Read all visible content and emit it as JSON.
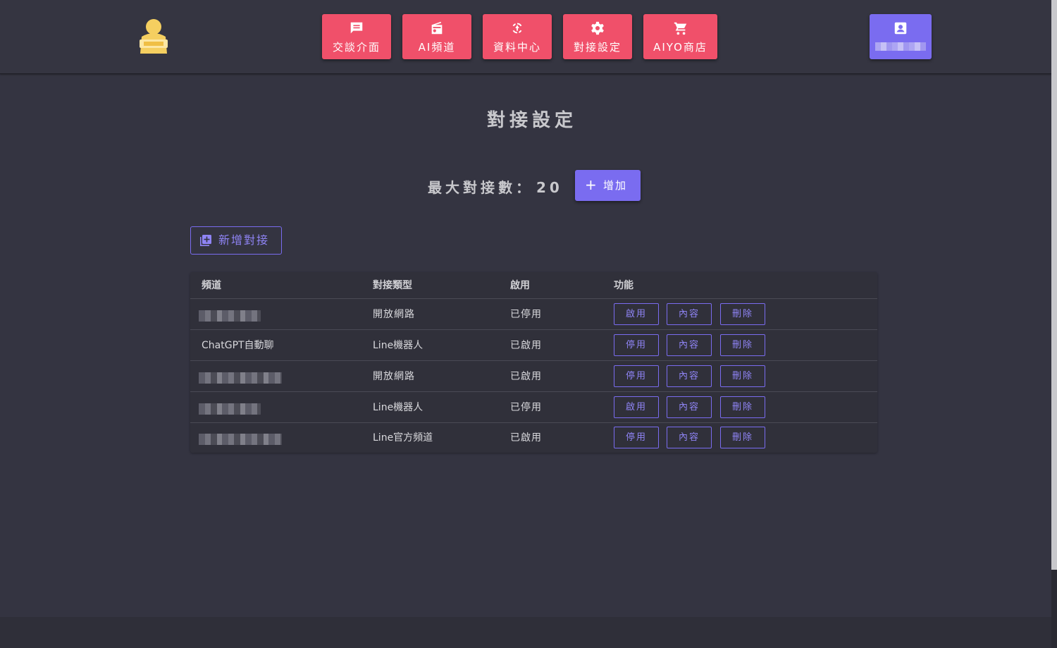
{
  "nav": {
    "items": [
      {
        "label": "交談介面",
        "icon": "chat-icon"
      },
      {
        "label": "AI頻道",
        "icon": "radio-icon"
      },
      {
        "label": "資料中心",
        "icon": "sync-icon"
      },
      {
        "label": "對接設定",
        "icon": "gear-icon"
      },
      {
        "label": "AIYO商店",
        "icon": "cart-icon"
      }
    ],
    "user_icon": "account-box-icon"
  },
  "page": {
    "title": "對接設定",
    "max_label": "最大對接數：",
    "max_value": "20",
    "add_label": "增加",
    "new_connection_label": "新增對接"
  },
  "table": {
    "headers": [
      "頻道",
      "對接類型",
      "啟用",
      "功能"
    ],
    "rows": [
      {
        "channel": "",
        "type": "開放網路",
        "status": "已停用",
        "toggle": "啟用",
        "detail": "內容",
        "delete": "刪除"
      },
      {
        "channel": "ChatGPT自動聊",
        "type": "Line機器人",
        "status": "已啟用",
        "toggle": "停用",
        "detail": "內容",
        "delete": "刪除"
      },
      {
        "channel": "",
        "type": "開放網路",
        "status": "已啟用",
        "toggle": "停用",
        "detail": "內容",
        "delete": "刪除"
      },
      {
        "channel": "",
        "type": "Line機器人",
        "status": "已停用",
        "toggle": "啟用",
        "detail": "內容",
        "delete": "刪除"
      },
      {
        "channel": "",
        "type": "Line官方頻道",
        "status": "已啟用",
        "toggle": "停用",
        "detail": "內容",
        "delete": "刪除"
      }
    ]
  },
  "colors": {
    "nav_button": "#f0506a",
    "accent": "#7a6cf0",
    "background": "#343441"
  }
}
